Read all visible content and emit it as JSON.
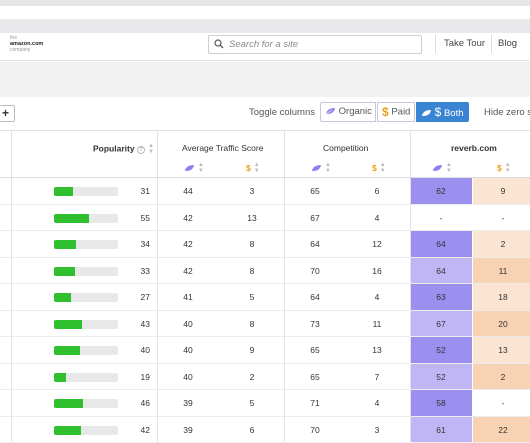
{
  "header": {
    "logo_line1": "the",
    "logo_brand": "amazon.com",
    "logo_line2": "company",
    "search_placeholder": "Search for a site",
    "nav": [
      "Take Tour",
      "Blog"
    ]
  },
  "toolbar": {
    "add_label": "+",
    "toggle_label": "Toggle columns",
    "segments": [
      "Organic",
      "Paid",
      "Both"
    ],
    "active_segment": "Both",
    "hide_zero": "Hide zero s"
  },
  "table": {
    "headers": {
      "popularity": "Popularity",
      "avg_traffic": "Average Traffic Score",
      "competition": "Competition",
      "site": "reverb.com"
    },
    "colors": {
      "bar_fill": "#2fbf2f",
      "organic_dark": "#9b8ff0",
      "organic_light": "#c0b6f6",
      "paid_dark": "#f8d3b3",
      "paid_light": "#fbe5d2",
      "active_toggle": "#3a84d4"
    },
    "rows": [
      {
        "pop_fill": 0.3,
        "pop": "31",
        "avg_o": "44",
        "avg_p": "3",
        "comp_o": "65",
        "comp_p": "6",
        "rev_o": "62",
        "rev_p": "9"
      },
      {
        "pop_fill": 0.55,
        "pop": "55",
        "avg_o": "42",
        "avg_p": "13",
        "comp_o": "67",
        "comp_p": "4",
        "rev_o": "-",
        "rev_p": "-"
      },
      {
        "pop_fill": 0.34,
        "pop": "34",
        "avg_o": "42",
        "avg_p": "8",
        "comp_o": "64",
        "comp_p": "12",
        "rev_o": "64",
        "rev_p": "2"
      },
      {
        "pop_fill": 0.33,
        "pop": "33",
        "avg_o": "42",
        "avg_p": "8",
        "comp_o": "70",
        "comp_p": "16",
        "rev_o": "64",
        "rev_p": "11"
      },
      {
        "pop_fill": 0.27,
        "pop": "27",
        "avg_o": "41",
        "avg_p": "5",
        "comp_o": "64",
        "comp_p": "4",
        "rev_o": "63",
        "rev_p": "18"
      },
      {
        "pop_fill": 0.43,
        "pop": "43",
        "avg_o": "40",
        "avg_p": "8",
        "comp_o": "73",
        "comp_p": "11",
        "rev_o": "67",
        "rev_p": "20"
      },
      {
        "pop_fill": 0.4,
        "pop": "40",
        "avg_o": "40",
        "avg_p": "9",
        "comp_o": "65",
        "comp_p": "13",
        "rev_o": "52",
        "rev_p": "13"
      },
      {
        "pop_fill": 0.19,
        "pop": "19",
        "avg_o": "40",
        "avg_p": "2",
        "comp_o": "65",
        "comp_p": "7",
        "rev_o": "52",
        "rev_p": "2"
      },
      {
        "pop_fill": 0.46,
        "pop": "46",
        "avg_o": "39",
        "avg_p": "5",
        "comp_o": "71",
        "comp_p": "4",
        "rev_o": "58",
        "rev_p": "-"
      },
      {
        "pop_fill": 0.42,
        "pop": "42",
        "avg_o": "39",
        "avg_p": "6",
        "comp_o": "70",
        "comp_p": "3",
        "rev_o": "61",
        "rev_p": "22"
      }
    ]
  }
}
